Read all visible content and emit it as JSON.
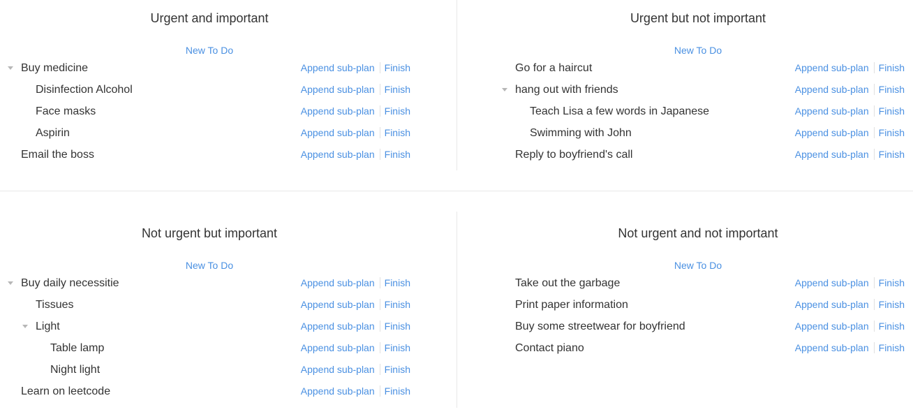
{
  "quadrants": {
    "q1": {
      "title": "Urgent and important",
      "new_todo": "New To Do",
      "items": [
        {
          "label": "Buy medicine",
          "level": 0,
          "expandable": true
        },
        {
          "label": "Disinfection Alcohol",
          "level": 1,
          "expandable": false
        },
        {
          "label": "Face masks",
          "level": 1,
          "expandable": false
        },
        {
          "label": "Aspirin",
          "level": 1,
          "expandable": false
        },
        {
          "label": "Email the boss",
          "level": 0,
          "expandable": false
        }
      ]
    },
    "q2": {
      "title": "Urgent but not important",
      "new_todo": "New To Do",
      "items": [
        {
          "label": "Go for a haircut",
          "level": 0,
          "expandable": false
        },
        {
          "label": "hang out with friends",
          "level": 0,
          "expandable": true
        },
        {
          "label": "Teach Lisa a few words in Japanese",
          "level": 1,
          "expandable": false
        },
        {
          "label": "Swimming with John",
          "level": 1,
          "expandable": false
        },
        {
          "label": "Reply to boyfriend's call",
          "level": 0,
          "expandable": false
        }
      ]
    },
    "q3": {
      "title": "Not urgent but important",
      "new_todo": "New To Do",
      "items": [
        {
          "label": "Buy daily necessitie",
          "level": 0,
          "expandable": true
        },
        {
          "label": "Tissues",
          "level": 1,
          "expandable": false
        },
        {
          "label": "Light",
          "level": 1,
          "expandable": true
        },
        {
          "label": "Table lamp",
          "level": 2,
          "expandable": false
        },
        {
          "label": "Night light",
          "level": 2,
          "expandable": false
        },
        {
          "label": "Learn on leetcode",
          "level": 0,
          "expandable": false
        }
      ]
    },
    "q4": {
      "title": "Not urgent and not important",
      "new_todo": "New To Do",
      "items": [
        {
          "label": "Take out the garbage",
          "level": 0,
          "expandable": false
        },
        {
          "label": "Print paper information",
          "level": 0,
          "expandable": false
        },
        {
          "label": "Buy some streetwear for boyfriend",
          "level": 0,
          "expandable": false
        },
        {
          "label": "Contact piano",
          "level": 0,
          "expandable": false
        }
      ]
    }
  },
  "actions": {
    "append_label": "Append sub-plan",
    "finish_label": "Finish"
  },
  "icons": {
    "expand": "caret-down-icon"
  },
  "colors": {
    "link": "#4a90e2",
    "text": "#333333",
    "caret": "#b7b7b7",
    "divider": "#e8e8e8"
  }
}
